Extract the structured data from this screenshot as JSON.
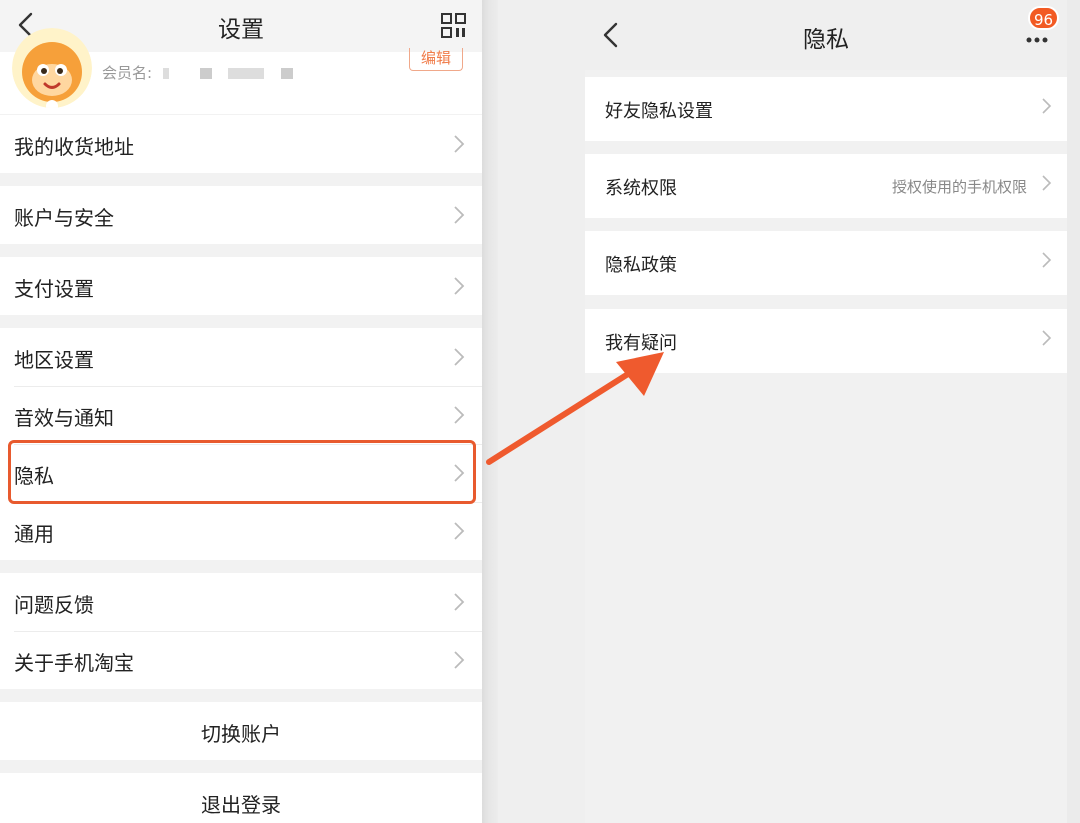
{
  "left": {
    "title": "设置",
    "profile": {
      "member_label": "会员名:",
      "edit_label": "编辑"
    },
    "items": [
      {
        "label": "我的收货地址"
      },
      {
        "label": "账户与安全"
      },
      {
        "label": "支付设置"
      },
      {
        "label": "地区设置"
      },
      {
        "label": "音效与通知"
      },
      {
        "label": "隐私"
      },
      {
        "label": "通用"
      },
      {
        "label": "问题反馈"
      },
      {
        "label": "关于手机淘宝"
      }
    ],
    "switch_account": "切换账户",
    "logout": "退出登录"
  },
  "right": {
    "title": "隐私",
    "badge": "96",
    "items": [
      {
        "label": "好友隐私设置",
        "sub": ""
      },
      {
        "label": "系统权限",
        "sub": "授权使用的手机权限"
      },
      {
        "label": "隐私政策",
        "sub": ""
      },
      {
        "label": "我有疑问",
        "sub": ""
      }
    ]
  },
  "colors": {
    "accent": "#f25a23",
    "highlight": "#e85a2e",
    "arrow": "#ef5a2e"
  },
  "icons": [
    "back-icon",
    "qr-scan-icon",
    "more-icon",
    "chevron-right-icon",
    "arrow-annotation-icon"
  ]
}
